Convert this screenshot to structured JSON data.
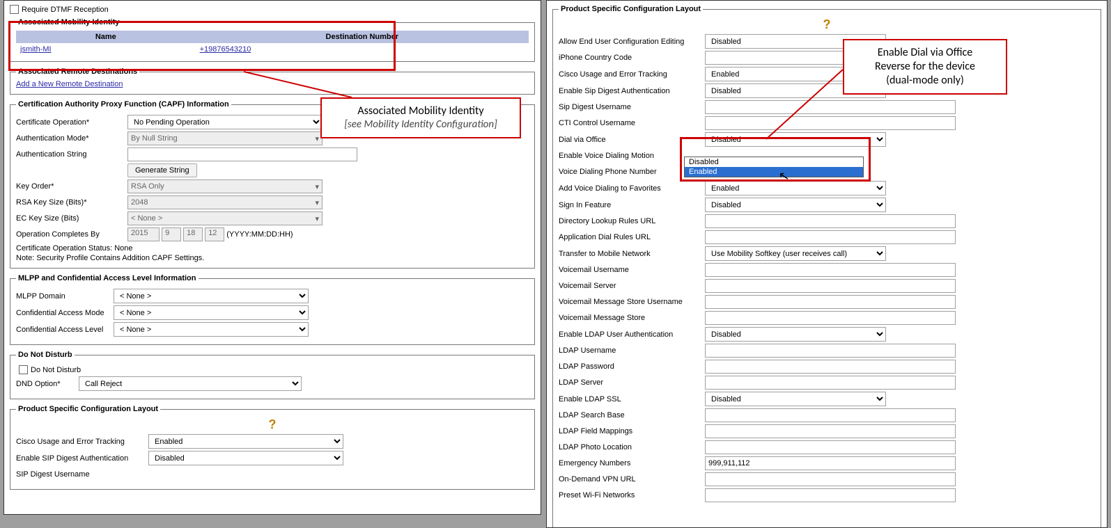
{
  "left": {
    "dtmf_label": "Require DTMF Reception",
    "mobility": {
      "legend": "Associated Mobility Identity",
      "col_name": "Name",
      "col_dest": "Destination Number",
      "row_name": "jsmith-MI",
      "row_dest": "+19876543210"
    },
    "remote": {
      "legend": "Associated Remote Destinations",
      "add_link": "Add a New Remote Destination"
    },
    "capf": {
      "legend": "Certification Authority Proxy Function (CAPF) Information",
      "cert_op_label": "Certificate Operation",
      "cert_op_value": "No Pending Operation",
      "auth_mode_label": "Authentication Mode",
      "auth_mode_value": "By Null String",
      "auth_string_label": "Authentication String",
      "gen_string_btn": "Generate String",
      "key_order_label": "Key Order",
      "key_order_value": "RSA Only",
      "rsa_key_label": "RSA Key Size (Bits)",
      "rsa_key_value": "2048",
      "ec_key_label": "EC Key Size (Bits)",
      "ec_key_value": "< None >",
      "op_completes_label": "Operation Completes By",
      "y": "2015",
      "m": "9",
      "d": "18",
      "h": "12",
      "date_hint": "(YYYY:MM:DD:HH)",
      "status_text": "Certificate Operation Status: None",
      "note_text": "Note: Security Profile Contains Addition CAPF Settings."
    },
    "mlpp": {
      "legend": "MLPP and Confidential Access Level Information",
      "domain_label": "MLPP Domain",
      "domain_value": "< None >",
      "mode_label": "Confidential Access Mode",
      "mode_value": "< None >",
      "level_label": "Confidential Access Level",
      "level_value": "< None >"
    },
    "dnd": {
      "legend": "Do Not Disturb",
      "chk_label": "Do Not Disturb",
      "dnd_option_label": "DND Option",
      "dnd_option_value": "Call Reject"
    },
    "pscl": {
      "legend": "Product Specific Configuration Layout",
      "help": "?",
      "usage_label": "Cisco Usage and Error Tracking",
      "usage_value": "Enabled",
      "sipauth_label": "Enable SIP Digest Authentication",
      "sipauth_value": "Disabled",
      "sipuser_label": "SIP Digest Username"
    }
  },
  "right": {
    "legend": "Product Specific Configuration Layout",
    "help": "?",
    "rows": {
      "allow_end_user": {
        "label": "Allow End User Configuration Editing",
        "value": "Disabled",
        "kind": "select"
      },
      "iphone_cc": {
        "label": "iPhone Country Code",
        "value": "",
        "kind": "text"
      },
      "cisco_usage": {
        "label": "Cisco Usage and Error Tracking",
        "value": "Enabled",
        "kind": "select"
      },
      "enable_sip": {
        "label": "Enable Sip Digest Authentication",
        "value": "Disabled",
        "kind": "select"
      },
      "sip_user": {
        "label": "Sip Digest Username",
        "value": "",
        "kind": "text"
      },
      "cti_user": {
        "label": "CTI Control Username",
        "value": "",
        "kind": "text"
      },
      "dial_office": {
        "label": "Dial via Office",
        "value": "Disabled",
        "kind": "select_open",
        "opt1": "Disabled",
        "opt2": "Enabled"
      },
      "voice_motion": {
        "label": "Enable Voice Dialing Motion",
        "value": "",
        "kind": "masked"
      },
      "voice_num": {
        "label": "Voice Dialing Phone Number",
        "value": "",
        "kind": "masked"
      },
      "voice_fav": {
        "label": "Add Voice Dialing to Favorites",
        "value": "Enabled",
        "kind": "select"
      },
      "signin": {
        "label": "Sign In Feature",
        "value": "Disabled",
        "kind": "select"
      },
      "dir_lookup": {
        "label": "Directory Lookup Rules URL",
        "value": "",
        "kind": "text"
      },
      "app_dial": {
        "label": "Application Dial Rules URL",
        "value": "",
        "kind": "text"
      },
      "transfer_mob": {
        "label": "Transfer to Mobile Network",
        "value": "Use Mobility Softkey (user receives call)",
        "kind": "select"
      },
      "vm_user": {
        "label": "Voicemail Username",
        "value": "",
        "kind": "text"
      },
      "vm_server": {
        "label": "Voicemail Server",
        "value": "",
        "kind": "text"
      },
      "vm_msgstore_u": {
        "label": "Voicemail Message Store Username",
        "value": "",
        "kind": "text"
      },
      "vm_msgstore": {
        "label": "Voicemail Message Store",
        "value": "",
        "kind": "text"
      },
      "ldap_auth": {
        "label": "Enable LDAP User Authentication",
        "value": "Disabled",
        "kind": "select"
      },
      "ldap_user": {
        "label": "LDAP Username",
        "value": "",
        "kind": "text"
      },
      "ldap_pass": {
        "label": "LDAP Password",
        "value": "",
        "kind": "text"
      },
      "ldap_server": {
        "label": "LDAP Server",
        "value": "",
        "kind": "text"
      },
      "ldap_ssl": {
        "label": "Enable LDAP SSL",
        "value": "Disabled",
        "kind": "select"
      },
      "ldap_search": {
        "label": "LDAP Search Base",
        "value": "",
        "kind": "text"
      },
      "ldap_field": {
        "label": "LDAP Field Mappings",
        "value": "",
        "kind": "text"
      },
      "ldap_photo": {
        "label": "LDAP Photo Location",
        "value": "",
        "kind": "text"
      },
      "emergency": {
        "label": "Emergency Numbers",
        "value": "999,911,112",
        "kind": "text"
      },
      "vpn_url": {
        "label": "On-Demand VPN URL",
        "value": "",
        "kind": "text"
      },
      "wifi_net": {
        "label": "Preset Wi-Fi Networks",
        "value": "",
        "kind": "text"
      }
    }
  },
  "callouts": {
    "mobility": {
      "title": "Associated Mobility Identity",
      "sub": "[see Mobility Identity Configuration]"
    },
    "dvo": {
      "l1": "Enable Dial via Office",
      "l2": "Reverse for the device",
      "l3": "(dual-mode only)"
    }
  }
}
